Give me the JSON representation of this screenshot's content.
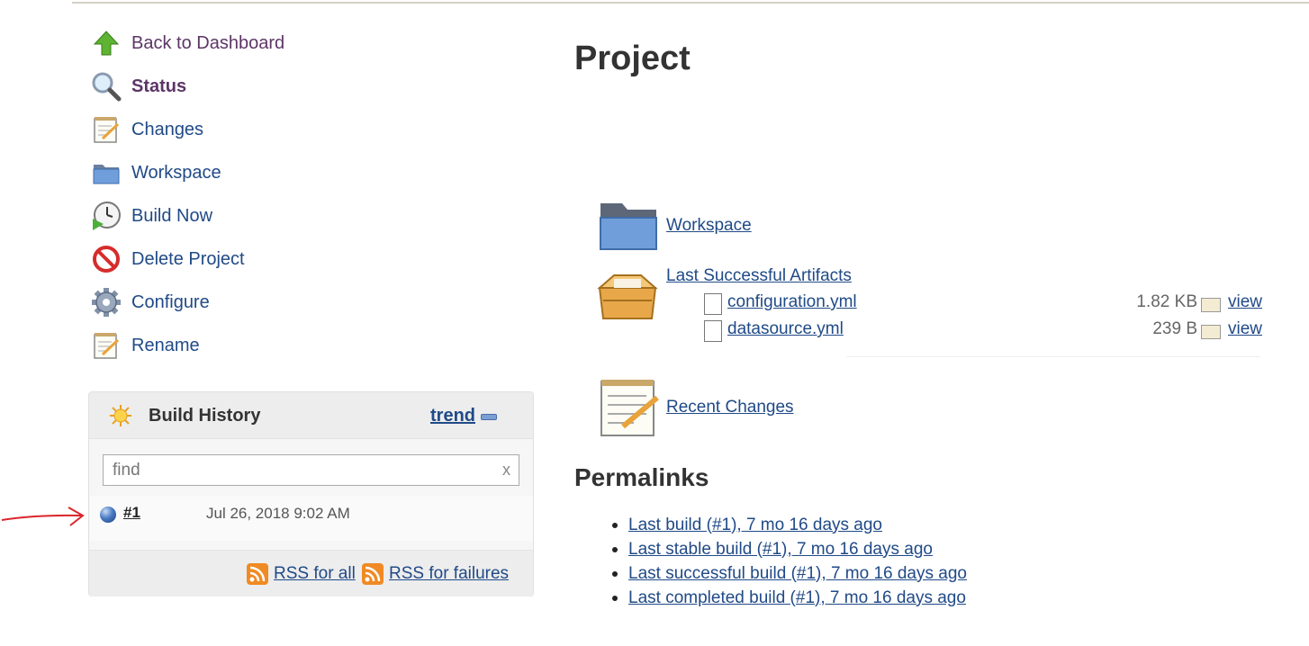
{
  "sidebar": {
    "tasks": [
      {
        "label": "Back to Dashboard",
        "icon": "up-arrow-icon"
      },
      {
        "label": "Status",
        "icon": "search-icon"
      },
      {
        "label": "Changes",
        "icon": "notepad-icon"
      },
      {
        "label": "Workspace",
        "icon": "folder-icon"
      },
      {
        "label": "Build Now",
        "icon": "clock-play-icon"
      },
      {
        "label": "Delete Project",
        "icon": "no-entry-icon"
      },
      {
        "label": "Configure",
        "icon": "gear-icon"
      },
      {
        "label": "Rename",
        "icon": "notepad-icon"
      }
    ]
  },
  "build_history": {
    "title": "Build History",
    "trend_label": "trend",
    "search_placeholder": "find",
    "clear_label": "x",
    "builds": [
      {
        "number": "#1",
        "date": "Jul 26, 2018 9:02 AM",
        "status_color": "#4a7bc4"
      }
    ],
    "rss_all": "RSS for all",
    "rss_failures": "RSS for failures"
  },
  "main": {
    "title": "Project",
    "workspace_link": "Workspace",
    "artifacts_link": "Last Successful Artifacts",
    "artifacts": [
      {
        "name": "configuration.yml",
        "size": "1.82 KB",
        "view": "view"
      },
      {
        "name": "datasource.yml",
        "size": "239 B",
        "view": "view"
      }
    ],
    "recent_changes_link": "Recent Changes",
    "permalinks_title": "Permalinks",
    "permalinks": [
      "Last build (#1), 7 mo 16 days ago",
      "Last stable build (#1), 7 mo 16 days ago",
      "Last successful build (#1), 7 mo 16 days ago",
      "Last completed build (#1), 7 mo 16 days ago"
    ]
  },
  "colors": {
    "link": "#204a87",
    "visited": "#5c3566",
    "annotation": "#d9262c"
  }
}
